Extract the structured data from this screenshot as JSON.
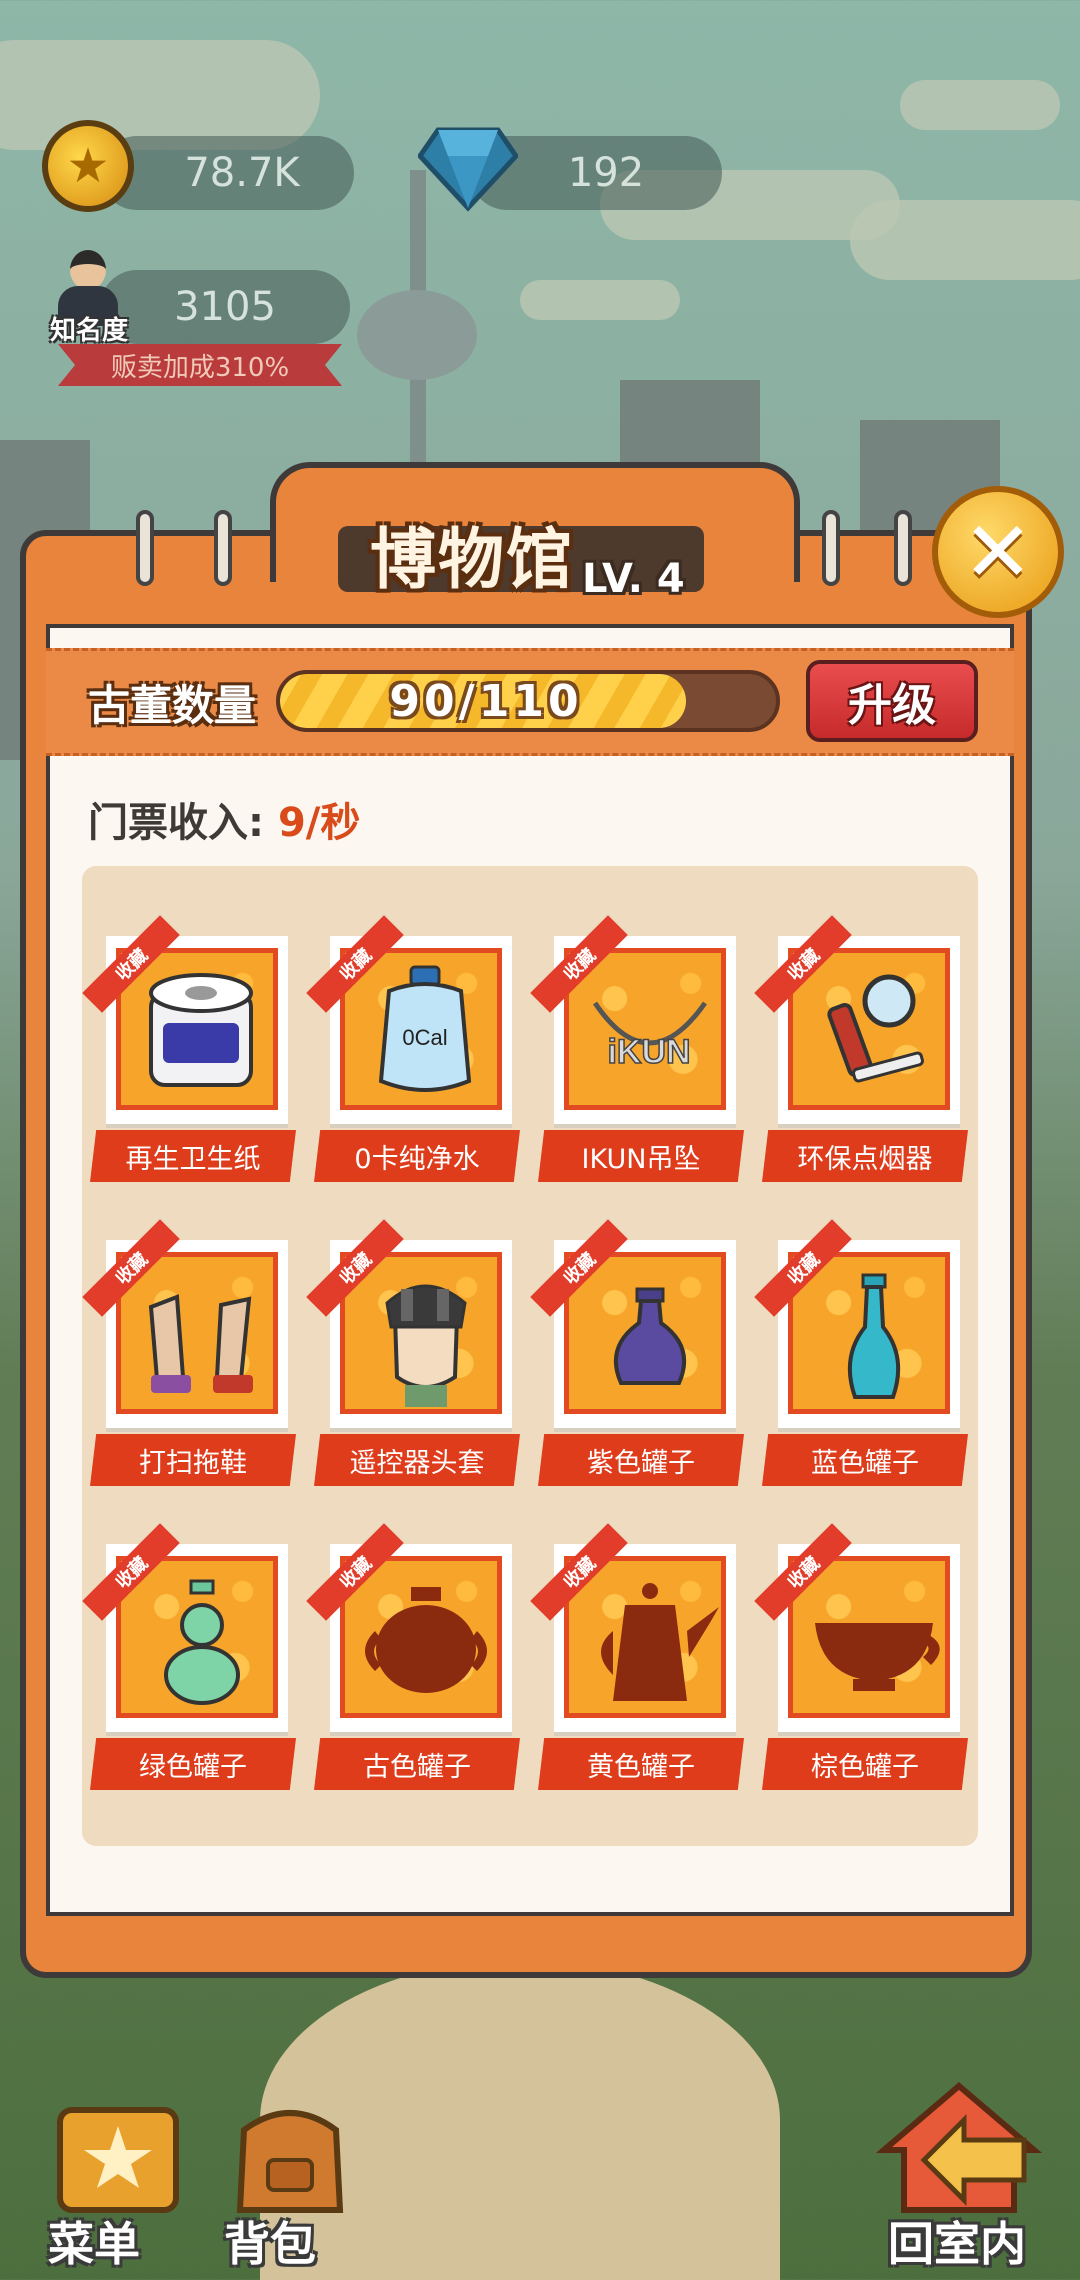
{
  "hud": {
    "coins": "78.7K",
    "gems": "192",
    "fame": "3105",
    "fame_label": "知名度",
    "sell_bonus": "贩卖加成310%"
  },
  "museum": {
    "title": "博物馆",
    "level": "LV. 4",
    "antique_label": "古董数量",
    "antique_progress": "90/110",
    "antique_current": 90,
    "antique_max": 110,
    "upgrade_label": "升级",
    "ticket_label": "门票收入:",
    "ticket_value": "9/秒",
    "badge_text": "收藏",
    "items": [
      {
        "name": "再生卫生纸",
        "icon": "toilet-paper-icon",
        "collected": true
      },
      {
        "name": "0卡纯净水",
        "icon": "water-jug-icon",
        "collected": true,
        "art_text": "0Cal"
      },
      {
        "name": "IKUN吊坠",
        "icon": "ikun-necklace-icon",
        "collected": true,
        "art_text": "iKUN"
      },
      {
        "name": "环保点烟器",
        "icon": "magnifier-lighter-icon",
        "collected": true
      },
      {
        "name": "打扫拖鞋",
        "icon": "mop-slippers-icon",
        "collected": true
      },
      {
        "name": "遥控器头套",
        "icon": "remote-headgear-icon",
        "collected": true
      },
      {
        "name": "紫色罐子",
        "icon": "purple-vase-icon",
        "collected": true
      },
      {
        "name": "蓝色罐子",
        "icon": "blue-vase-icon",
        "collected": true
      },
      {
        "name": "绿色罐子",
        "icon": "green-gourd-vase-icon",
        "collected": true
      },
      {
        "name": "古色罐子",
        "icon": "ancient-pot-silhouette-icon",
        "collected": false
      },
      {
        "name": "黄色罐子",
        "icon": "teapot-silhouette-icon",
        "collected": false
      },
      {
        "name": "棕色罐子",
        "icon": "bowl-silhouette-icon",
        "collected": false
      }
    ]
  },
  "bottom_nav": {
    "menu": "菜单",
    "bag": "背包",
    "back_home": "回室内"
  },
  "colors": {
    "panel_orange": "#e8843c",
    "accent_red": "#df3c1c",
    "progress_yellow": "#ffd14a",
    "ticket_value": "#d94b1a",
    "silhouette": "#8a2b10"
  }
}
